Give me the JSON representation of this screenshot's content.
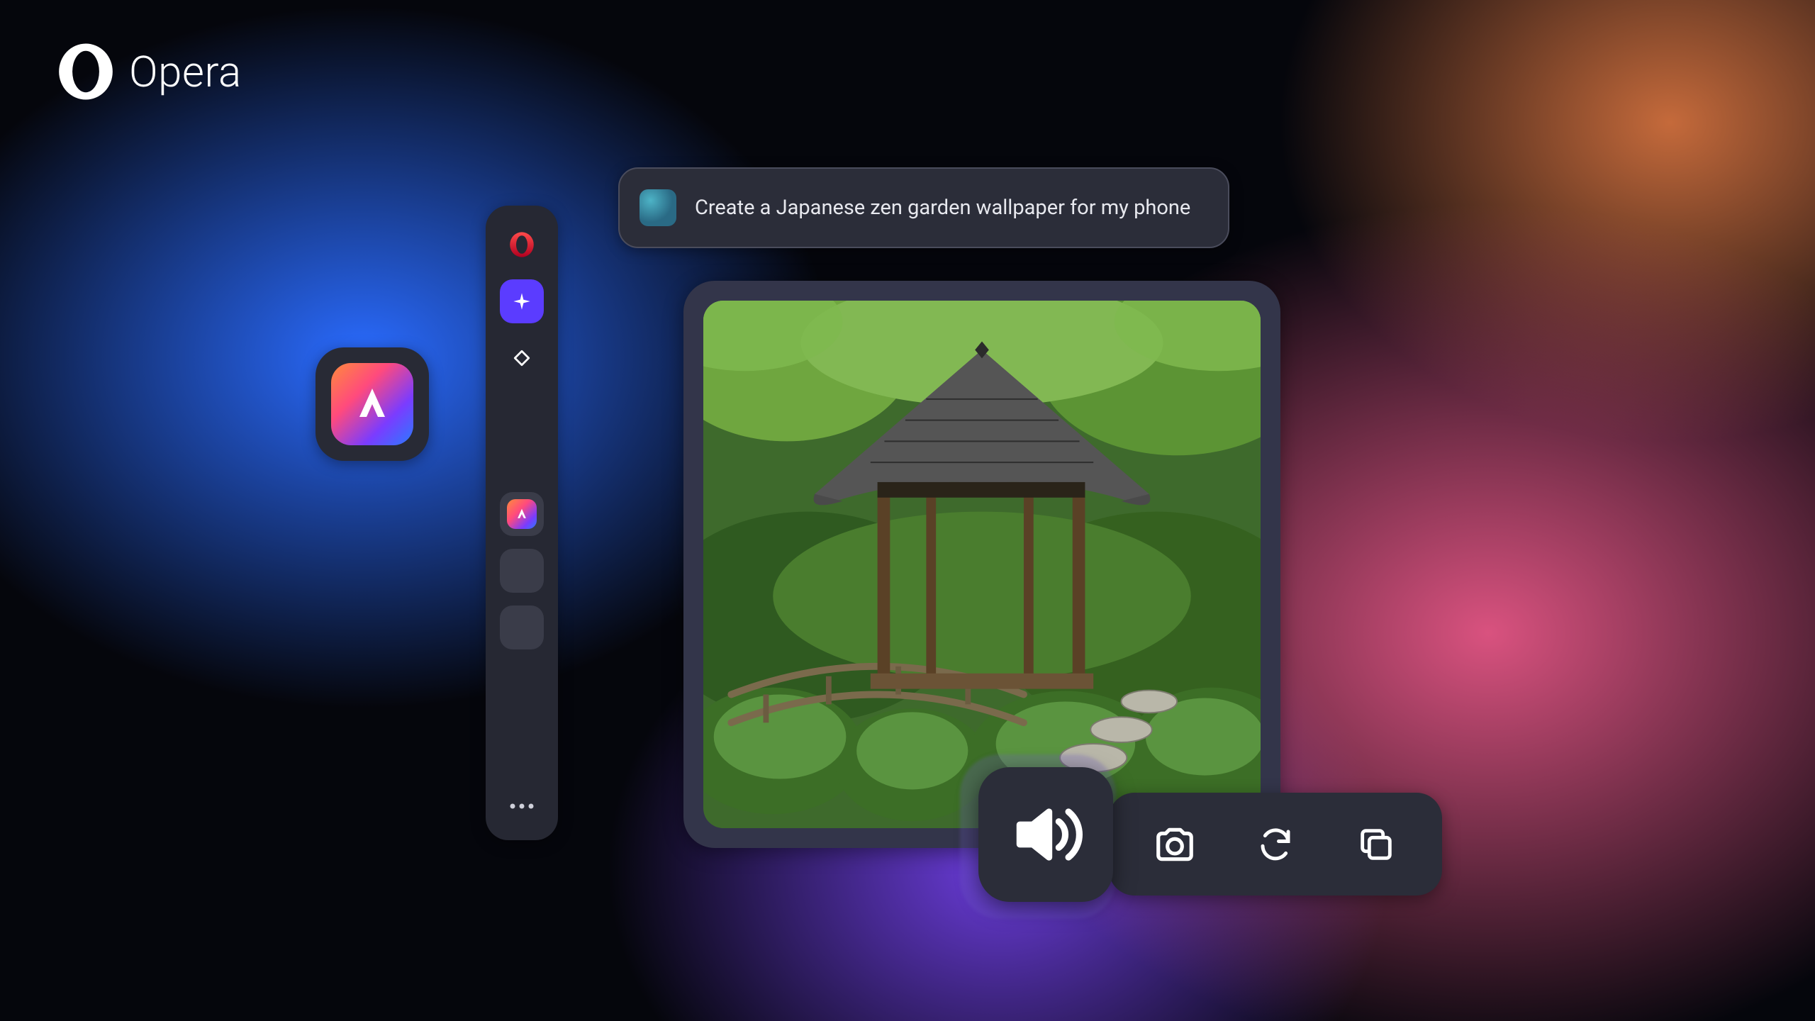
{
  "brand": {
    "name": "Opera"
  },
  "prompt": {
    "text": "Create a Japanese zen garden  wallpaper for my phone"
  },
  "sidebar": {
    "items": [
      {
        "id": "opera",
        "icon": "opera-o-icon"
      },
      {
        "id": "ai",
        "icon": "sparkle-icon"
      },
      {
        "id": "diamond",
        "icon": "diamond-outline-icon"
      },
      {
        "id": "aria-app",
        "icon": "aria-app-icon"
      },
      {
        "id": "slot-1",
        "icon": "empty-slot"
      },
      {
        "id": "slot-2",
        "icon": "empty-slot"
      }
    ],
    "more_icon": "more-horizontal-icon"
  },
  "result": {
    "alt": "Generated Japanese zen garden wallpaper"
  },
  "actions": {
    "speaker": "speaker-icon",
    "camera": "camera-icon",
    "refresh": "refresh-icon",
    "copy": "copy-icon"
  }
}
